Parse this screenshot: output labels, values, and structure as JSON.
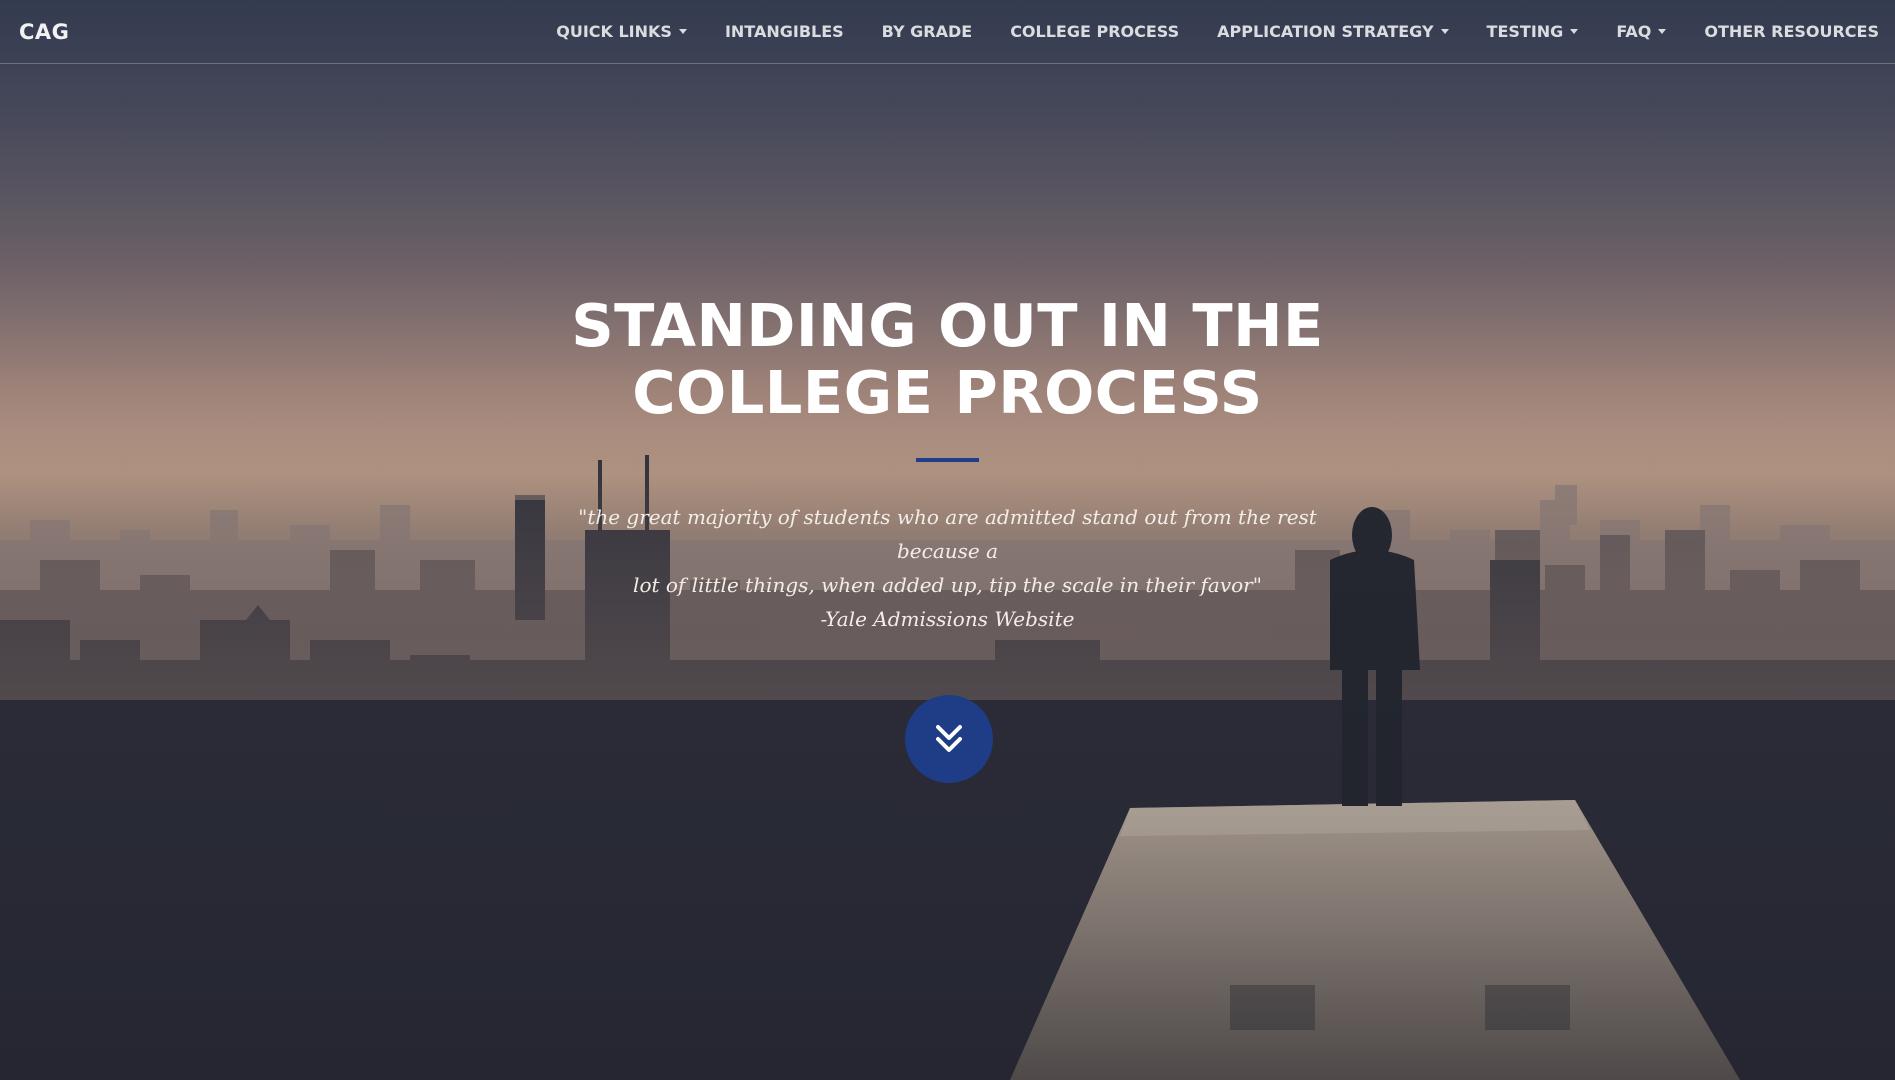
{
  "navbar": {
    "brand": "CAG",
    "items": [
      {
        "label": "QUICK LINKS",
        "dropdown": true
      },
      {
        "label": "INTANGIBLES",
        "dropdown": false
      },
      {
        "label": "BY GRADE",
        "dropdown": false
      },
      {
        "label": "COLLEGE PROCESS",
        "dropdown": false
      },
      {
        "label": "APPLICATION STRATEGY",
        "dropdown": true
      },
      {
        "label": "TESTING",
        "dropdown": true
      },
      {
        "label": "FAQ",
        "dropdown": true
      },
      {
        "label": "OTHER RESOURCES",
        "dropdown": false
      }
    ]
  },
  "header": {
    "title": "STANDING OUT IN THE COLLEGE PROCESS",
    "quote_line1": "\"the great majority of students who are admitted stand out from the rest because a",
    "quote_line2": "lot of little things, when added up, tip the scale in their favor\"",
    "attribution": "-Yale Admissions Website",
    "scroll_icon": "double-chevron-down-icon"
  },
  "colors": {
    "accent": "#1f3c86",
    "divider": "#1f3e8c",
    "text": "#ffffff"
  }
}
